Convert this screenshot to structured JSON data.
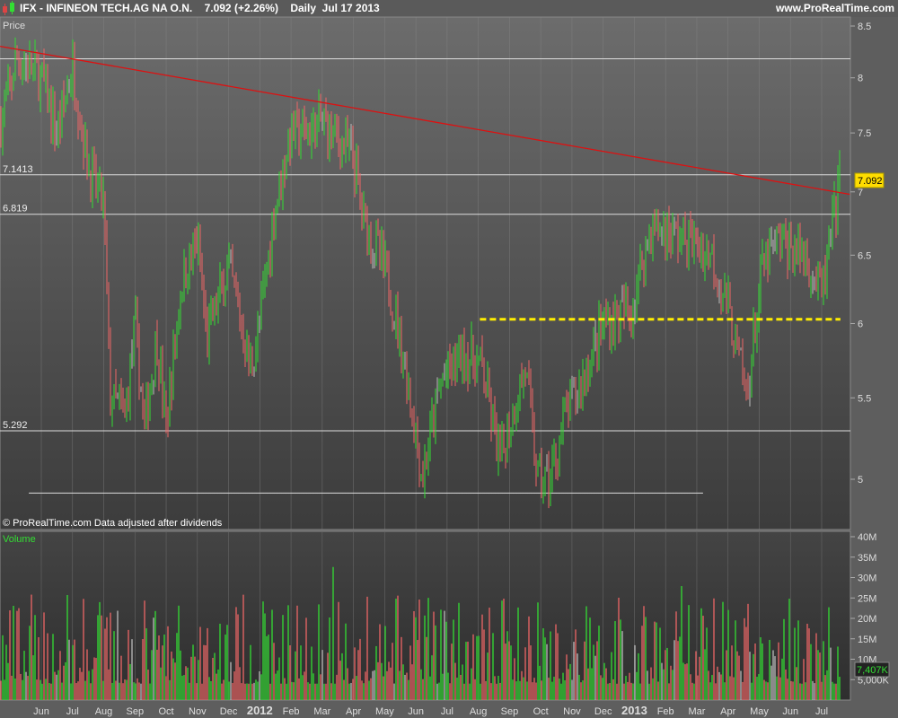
{
  "header": {
    "symbol_title": "IFX - INFINEON TECH.AG NA O.N.",
    "last": "7.092 (+2.26%)",
    "period": "Daily",
    "date": "Jul 17 2013",
    "site": "www.ProRealTime.com"
  },
  "price_panel": {
    "label": "Price",
    "copyright": "© ProRealTime.com  Data adjusted after dividends",
    "current_price": "7.092"
  },
  "volume_panel": {
    "label": "Volume",
    "current_volume": "7,407K"
  },
  "chart_data": {
    "type": "candlestick",
    "title": "IFX - INFINEON TECH.AG NA O.N. Daily",
    "price_axis": {
      "scale": "log",
      "ylim": [
        4.8,
        8.5
      ],
      "ticks": [
        "8.5",
        "8",
        "7.5",
        "7",
        "6.5",
        "6",
        "5.5",
        "5"
      ],
      "tick_values": [
        8.5,
        8,
        7.5,
        7,
        6.5,
        6,
        5.5,
        5
      ]
    },
    "volume_axis": {
      "ylim": [
        0,
        40
      ],
      "unit": "M",
      "ticks": [
        "40M",
        "35M",
        "30M",
        "25M",
        "20M",
        "15M",
        "10M",
        "5,000K"
      ],
      "tick_values": [
        40,
        35,
        30,
        25,
        20,
        15,
        10,
        5
      ]
    },
    "x_ticks": [
      {
        "label": "Jun"
      },
      {
        "label": "Jul"
      },
      {
        "label": "Aug"
      },
      {
        "label": "Sep"
      },
      {
        "label": "Oct"
      },
      {
        "label": "Nov"
      },
      {
        "label": "Dec"
      },
      {
        "label": "2012",
        "bold": true
      },
      {
        "label": "Feb"
      },
      {
        "label": "Mar"
      },
      {
        "label": "Apr"
      },
      {
        "label": "May"
      },
      {
        "label": "Jun"
      },
      {
        "label": "Jul"
      },
      {
        "label": "Aug"
      },
      {
        "label": "Sep"
      },
      {
        "label": "Oct"
      },
      {
        "label": "Nov"
      },
      {
        "label": "Dec"
      },
      {
        "label": "2013",
        "bold": true
      },
      {
        "label": "Feb"
      },
      {
        "label": "Mar"
      },
      {
        "label": "Apr"
      },
      {
        "label": "May"
      },
      {
        "label": "Jun"
      },
      {
        "label": "Jul"
      }
    ],
    "price_path_monthly_index": [
      [
        -1.3,
        7.6
      ],
      [
        -1.0,
        7.9
      ],
      [
        -0.8,
        8.2
      ],
      [
        0,
        8.0
      ],
      [
        0.5,
        7.5
      ],
      [
        1,
        8.1
      ],
      [
        1.5,
        7.2
      ],
      [
        2,
        6.9
      ],
      [
        2.2,
        5.5
      ],
      [
        2.7,
        5.4
      ],
      [
        3,
        6.0
      ],
      [
        3.3,
        5.3
      ],
      [
        3.7,
        5.9
      ],
      [
        4,
        5.3
      ],
      [
        4.5,
        6.3
      ],
      [
        5,
        6.6
      ],
      [
        5.3,
        5.9
      ],
      [
        6,
        6.4
      ],
      [
        6.7,
        5.7
      ],
      [
        7,
        6.0
      ],
      [
        7.5,
        6.9
      ],
      [
        8,
        7.5
      ],
      [
        8.5,
        7.5
      ],
      [
        9,
        7.6
      ],
      [
        10,
        7.3
      ],
      [
        10.3,
        6.8
      ],
      [
        11,
        6.4
      ],
      [
        11.5,
        5.9
      ],
      [
        12.2,
        5.0
      ],
      [
        12.8,
        5.6
      ],
      [
        13.5,
        5.8
      ],
      [
        14.1,
        5.7
      ],
      [
        14.7,
        5.1
      ],
      [
        15.5,
        5.7
      ],
      [
        15.9,
        5.0
      ],
      [
        16.3,
        5.0
      ],
      [
        16.8,
        5.4
      ],
      [
        17.3,
        5.6
      ],
      [
        18,
        6.0
      ],
      [
        18.9,
        6.1
      ],
      [
        19.5,
        6.7
      ],
      [
        20,
        6.7
      ],
      [
        20.8,
        6.6
      ],
      [
        21.5,
        6.5
      ],
      [
        22,
        6.1
      ],
      [
        22.6,
        5.5
      ],
      [
        23.1,
        6.4
      ],
      [
        23.6,
        6.6
      ],
      [
        24.5,
        6.5
      ],
      [
        25.0,
        6.2
      ],
      [
        25.4,
        6.8
      ],
      [
        25.58,
        7.09
      ]
    ],
    "horizontal_levels": [
      {
        "value": 8.18,
        "label": ""
      },
      {
        "value": 7.1413,
        "label": "7.1413"
      },
      {
        "value": 6.819,
        "label": "6.819"
      },
      {
        "value": 5.292,
        "label": "5.292"
      }
    ],
    "support_line": {
      "value": 4.92,
      "from": -0.4,
      "to": 21.2
    },
    "yellow_dashed_level": {
      "value": 6.03,
      "from": 14.05,
      "to": 25.6
    },
    "trendline": {
      "from": [
        -1.32,
        8.3
      ],
      "to": [
        25.9,
        6.98
      ]
    },
    "colors": {
      "up": "#33dd33",
      "down": "#ee6666",
      "neutral": "#bbbbbb",
      "trend": "#dd1111",
      "level": "#dddddd",
      "dashed": "#ffee00",
      "price_box": "#ffdd00"
    }
  }
}
